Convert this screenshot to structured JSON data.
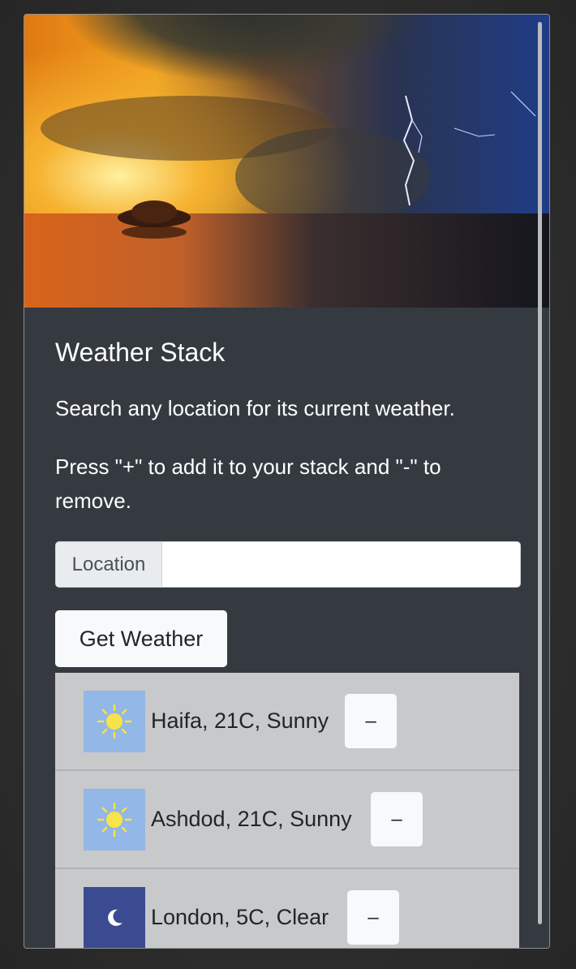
{
  "app": {
    "title": "Weather Stack",
    "description_line1": "Search any location for its current weather.",
    "description_line2": "Press \"+\" to add it to your stack and \"-\" to remove."
  },
  "search": {
    "label": "Location",
    "value": "",
    "placeholder": ""
  },
  "get_weather_button": {
    "label": "Get Weather"
  },
  "stack": {
    "items": [
      {
        "text": "Haifa, 21C, Sunny",
        "icon": "sun-icon",
        "remove_label": "–"
      },
      {
        "text": "Ashdod, 21C, Sunny",
        "icon": "sun-icon",
        "remove_label": "–"
      },
      {
        "text": "London, 5C, Clear",
        "icon": "moon-icon",
        "remove_label": "–"
      }
    ]
  },
  "colors": {
    "card_bg": "#343a40",
    "list_bg": "#c8c9cb",
    "sunny_icon_bg": "#93b7e6",
    "clear_icon_bg": "#3a4b91",
    "button_bg": "#f8f9fa"
  }
}
